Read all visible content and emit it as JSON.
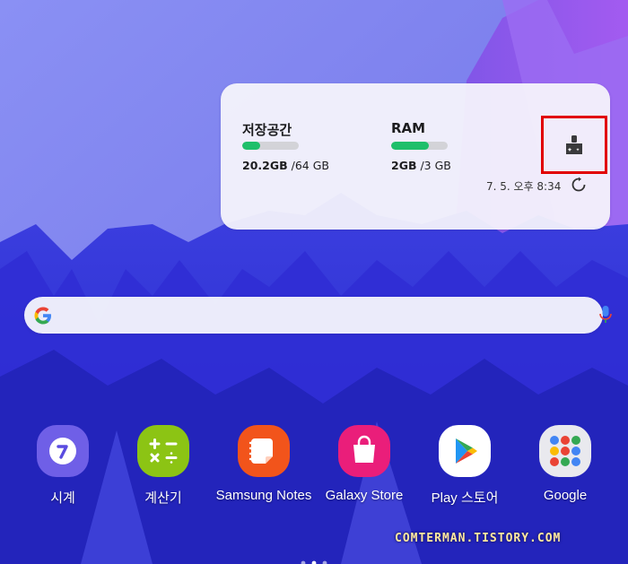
{
  "widget": {
    "storage": {
      "label": "저장공간",
      "used": "20.2GB",
      "total": " /64 GB",
      "fill_fraction": 0.32,
      "fill_color": "#1fbf6a"
    },
    "ram": {
      "label": "RAM",
      "used": "2GB",
      "total": " /3 GB",
      "fill_fraction": 0.67,
      "fill_color": "#1fbf6a"
    },
    "clean_icon": "broom-sparkle-icon",
    "updated_time": "7. 5. 오후 8:34",
    "refresh_icon": "refresh-icon"
  },
  "search": {
    "logo": "google-g-icon",
    "mic_icon": "mic-icon"
  },
  "apps": [
    {
      "label": "시계",
      "icon": "clock-icon"
    },
    {
      "label": "계산기",
      "icon": "calculator-icon"
    },
    {
      "label": "Samsung Notes",
      "icon": "notes-icon"
    },
    {
      "label": "Galaxy Store",
      "icon": "store-bag-icon"
    },
    {
      "label": "Play 스토어",
      "icon": "play-store-icon"
    },
    {
      "label": "Google",
      "icon": "google-folder-icon"
    }
  ],
  "watermark": "COMTERMAN.TISTORY.COM"
}
